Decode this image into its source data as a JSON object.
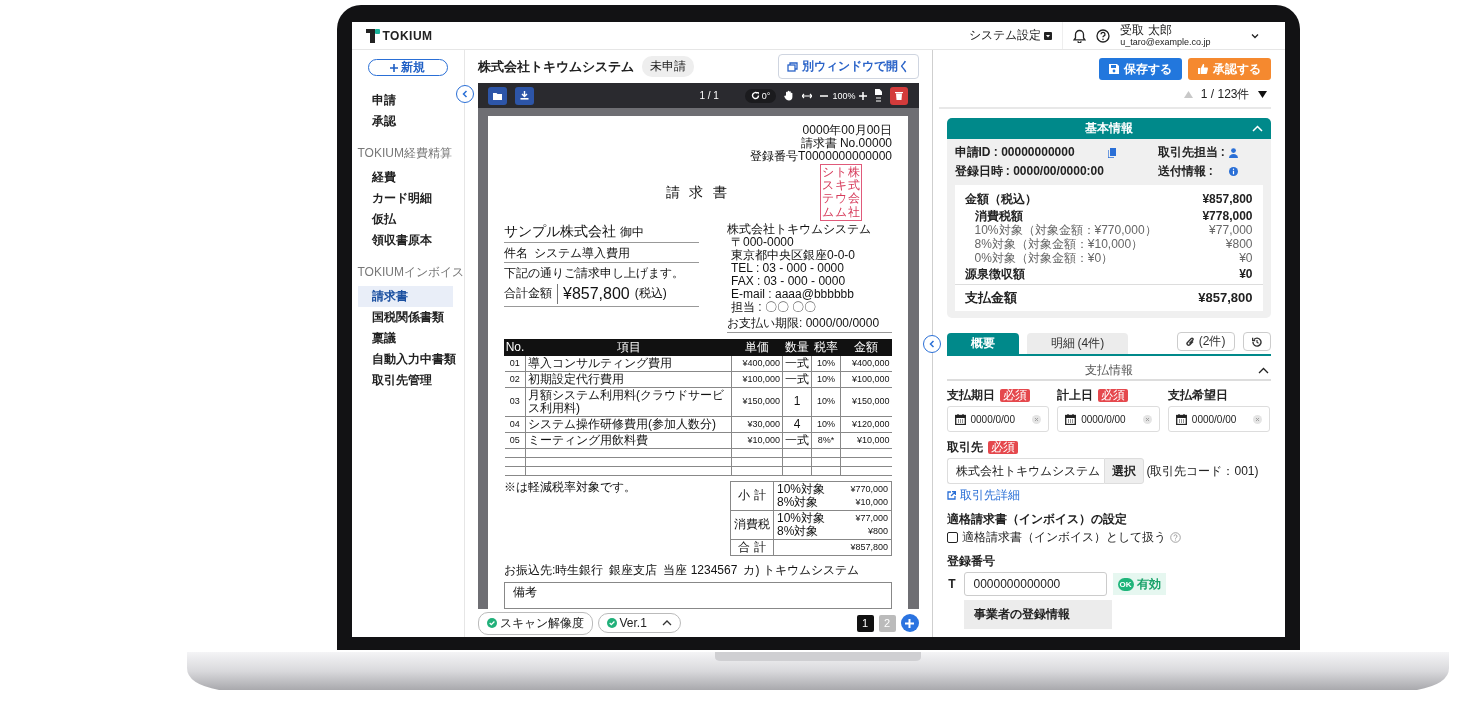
{
  "header": {
    "logo": "TOKIUM",
    "settings_menu": "システム設定",
    "user_name": "受取 太郎",
    "user_email": "u_taro@example.co.jp"
  },
  "sidebar": {
    "new_button": "新規",
    "sections": [
      {
        "items": [
          {
            "label": "申請",
            "selected": false
          },
          {
            "label": "承認",
            "selected": false
          }
        ]
      },
      {
        "heading": "TOKIUM経費精算",
        "items": [
          {
            "label": "経費",
            "selected": false
          },
          {
            "label": "カード明細",
            "selected": false
          },
          {
            "label": "仮払",
            "selected": false
          },
          {
            "label": "領収書原本",
            "selected": false
          }
        ]
      },
      {
        "heading": "TOKIUMインボイス",
        "items": [
          {
            "label": "請求書",
            "selected": true
          },
          {
            "label": "国税関係書類",
            "selected": false
          },
          {
            "label": "稟議",
            "selected": false
          },
          {
            "label": "自動入力中書類",
            "selected": false
          },
          {
            "label": "取引先管理",
            "selected": false
          }
        ]
      }
    ]
  },
  "document": {
    "title": "株式会社トキウムシステム",
    "status": "未申請",
    "open_window_button": "別ウィンドウで開く",
    "viewer": {
      "page_indicator": "1 / 1",
      "rotation": "0°",
      "zoom": "100%"
    },
    "invoice": {
      "meta": [
        "0000年00月00日",
        "請求書 No.00000",
        "登録番号T0000000000000"
      ],
      "title": "請 求 書",
      "stamp": [
        "システム",
        "トキウム",
        "株式会社"
      ],
      "recipient": "サンプル株式会社",
      "honorific": "御中",
      "subject_label": "件名",
      "subject": "システム導入費用",
      "intro": "下記の通りご請求申し上げます。",
      "total_label": "合計金額",
      "total": "¥857,800",
      "tax_note": "(税込)",
      "issuer": "株式会社トキウムシステム",
      "address": [
        "〒000-0000",
        "東京都中央区銀座0-0-0",
        "TEL : 03 - 000 - 0000",
        "FAX : 03 - 000 - 0000",
        "E-mail : aaaa@bbbbbb",
        "担当 : 〇〇 〇〇"
      ],
      "due": "お支払い期限: 0000/00/0000",
      "columns": [
        "No.",
        "項目",
        "単価",
        "数量",
        "税率",
        "金額"
      ],
      "rows": [
        [
          "01",
          "導入コンサルティング費用",
          "¥400,000",
          "一式",
          "10%",
          "¥400,000"
        ],
        [
          "02",
          "初期設定代行費用",
          "¥100,000",
          "一式",
          "10%",
          "¥100,000"
        ],
        [
          "03",
          "月額システム利用料(クラウドサービス利用料)",
          "¥150,000",
          "1",
          "10%",
          "¥150,000"
        ],
        [
          "04",
          "システム操作研修費用(参加人数分)",
          "¥30,000",
          "4",
          "10%",
          "¥120,000"
        ],
        [
          "05",
          "ミーティング用飲料費",
          "¥10,000",
          "一式",
          "8%*",
          "¥10,000"
        ]
      ],
      "reduced_note": "※は軽減税率対象です。",
      "summary": [
        {
          "label": "小 計",
          "lines": [
            {
              "label": "10%対象",
              "value": "¥770,000"
            },
            {
              "label": "8%対象",
              "value": "¥10,000"
            }
          ]
        },
        {
          "label": "消費税",
          "lines": [
            {
              "label": "10%対象",
              "value": "¥77,000"
            },
            {
              "label": "8%対象",
              "value": "¥800"
            }
          ]
        },
        {
          "label": "合 計",
          "lines": [
            {
              "value": "¥857,800"
            }
          ]
        }
      ],
      "bank": [
        "お振込先:時生銀行",
        "銀座支店",
        "当座 1234567",
        "カ) トキウムシステム"
      ],
      "remarks_label": "備考"
    },
    "footer": {
      "chips": [
        {
          "kind": "status",
          "label": "スキャン解像度"
        },
        {
          "kind": "version",
          "label": "Ver.1"
        }
      ],
      "pages": [
        {
          "label": "1",
          "selected": true
        },
        {
          "label": "2",
          "selected": false
        }
      ]
    }
  },
  "detail": {
    "save_button": "保存する",
    "approve_button": "承認する",
    "pager": "1 / 123件",
    "basic_info": {
      "title": "基本情報",
      "expanded": true,
      "application_id": "申請ID : 00000000000",
      "registered_at": "登録日時 : 0000/00/0000:00",
      "partner_contact": "取引先担当 :",
      "delivery_info": "送付情報 :",
      "amounts": [
        {
          "kind": "main",
          "label": "金額（税込）",
          "value": "¥857,800"
        },
        {
          "kind": "sub",
          "label": "消費税額",
          "value": "¥778,000"
        },
        {
          "kind": "detail",
          "label": "10%対象（対象金額：¥770,000）",
          "value": "¥77,000"
        },
        {
          "kind": "detail",
          "label": "8%対象（対象金額：¥10,000）",
          "value": "¥800"
        },
        {
          "kind": "detail",
          "label": "0%対象（対象金額：¥0）",
          "value": "¥0"
        },
        {
          "kind": "main",
          "label": "源泉徴収額",
          "value": "¥0"
        }
      ],
      "payment_total": {
        "label": "支払金額",
        "value": "¥857,800"
      }
    },
    "tabs": [
      {
        "label": "概要",
        "selected": true
      },
      {
        "label": "明細",
        "count": "(4件)",
        "selected": false
      }
    ],
    "attachments_button": "(2件)",
    "payment_section": {
      "title": "支払情報",
      "expanded": true
    },
    "date_fields": [
      {
        "label": "支払期日",
        "badge": "必須",
        "value": "0000/0/00"
      },
      {
        "label": "計上日",
        "badge": "必須",
        "value": "0000/0/00"
      },
      {
        "label": "支払希望日",
        "value": "0000/0/00"
      }
    ],
    "partner": {
      "label": "取引先",
      "badge": "必須",
      "value": "株式会社トキウムシステム",
      "select_button": "選択",
      "code": "(取引先コード：001)",
      "detail_link": "取引先詳細"
    },
    "invoice_setting": {
      "title": "適格請求書（インボイス）の設定",
      "checkbox_label": "適格請求書（インボイス）として扱う",
      "checked": false
    },
    "registration": {
      "label": "登録番号",
      "prefix": "T",
      "value": "0000000000000",
      "status_icon": "OK",
      "status": "有効",
      "registrant_info": "事業者の登録情報"
    }
  }
}
